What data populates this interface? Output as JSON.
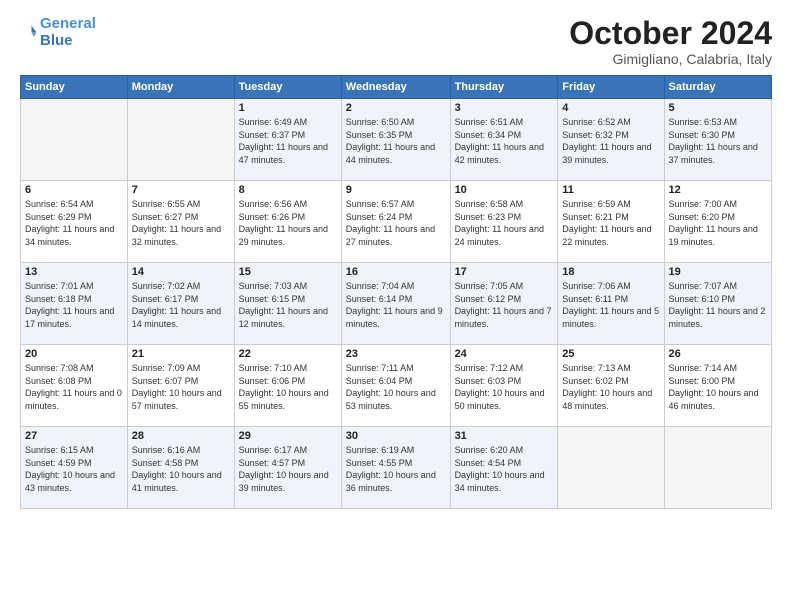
{
  "header": {
    "logo_line1": "General",
    "logo_line2": "Blue",
    "month_title": "October 2024",
    "location": "Gimigliano, Calabria, Italy"
  },
  "days_of_week": [
    "Sunday",
    "Monday",
    "Tuesday",
    "Wednesday",
    "Thursday",
    "Friday",
    "Saturday"
  ],
  "weeks": [
    [
      {
        "num": "",
        "detail": ""
      },
      {
        "num": "",
        "detail": ""
      },
      {
        "num": "1",
        "detail": "Sunrise: 6:49 AM\nSunset: 6:37 PM\nDaylight: 11 hours\nand 47 minutes."
      },
      {
        "num": "2",
        "detail": "Sunrise: 6:50 AM\nSunset: 6:35 PM\nDaylight: 11 hours\nand 44 minutes."
      },
      {
        "num": "3",
        "detail": "Sunrise: 6:51 AM\nSunset: 6:34 PM\nDaylight: 11 hours\nand 42 minutes."
      },
      {
        "num": "4",
        "detail": "Sunrise: 6:52 AM\nSunset: 6:32 PM\nDaylight: 11 hours\nand 39 minutes."
      },
      {
        "num": "5",
        "detail": "Sunrise: 6:53 AM\nSunset: 6:30 PM\nDaylight: 11 hours\nand 37 minutes."
      }
    ],
    [
      {
        "num": "6",
        "detail": "Sunrise: 6:54 AM\nSunset: 6:29 PM\nDaylight: 11 hours\nand 34 minutes."
      },
      {
        "num": "7",
        "detail": "Sunrise: 6:55 AM\nSunset: 6:27 PM\nDaylight: 11 hours\nand 32 minutes."
      },
      {
        "num": "8",
        "detail": "Sunrise: 6:56 AM\nSunset: 6:26 PM\nDaylight: 11 hours\nand 29 minutes."
      },
      {
        "num": "9",
        "detail": "Sunrise: 6:57 AM\nSunset: 6:24 PM\nDaylight: 11 hours\nand 27 minutes."
      },
      {
        "num": "10",
        "detail": "Sunrise: 6:58 AM\nSunset: 6:23 PM\nDaylight: 11 hours\nand 24 minutes."
      },
      {
        "num": "11",
        "detail": "Sunrise: 6:59 AM\nSunset: 6:21 PM\nDaylight: 11 hours\nand 22 minutes."
      },
      {
        "num": "12",
        "detail": "Sunrise: 7:00 AM\nSunset: 6:20 PM\nDaylight: 11 hours\nand 19 minutes."
      }
    ],
    [
      {
        "num": "13",
        "detail": "Sunrise: 7:01 AM\nSunset: 6:18 PM\nDaylight: 11 hours\nand 17 minutes."
      },
      {
        "num": "14",
        "detail": "Sunrise: 7:02 AM\nSunset: 6:17 PM\nDaylight: 11 hours\nand 14 minutes."
      },
      {
        "num": "15",
        "detail": "Sunrise: 7:03 AM\nSunset: 6:15 PM\nDaylight: 11 hours\nand 12 minutes."
      },
      {
        "num": "16",
        "detail": "Sunrise: 7:04 AM\nSunset: 6:14 PM\nDaylight: 11 hours\nand 9 minutes."
      },
      {
        "num": "17",
        "detail": "Sunrise: 7:05 AM\nSunset: 6:12 PM\nDaylight: 11 hours\nand 7 minutes."
      },
      {
        "num": "18",
        "detail": "Sunrise: 7:06 AM\nSunset: 6:11 PM\nDaylight: 11 hours\nand 5 minutes."
      },
      {
        "num": "19",
        "detail": "Sunrise: 7:07 AM\nSunset: 6:10 PM\nDaylight: 11 hours\nand 2 minutes."
      }
    ],
    [
      {
        "num": "20",
        "detail": "Sunrise: 7:08 AM\nSunset: 6:08 PM\nDaylight: 11 hours\nand 0 minutes."
      },
      {
        "num": "21",
        "detail": "Sunrise: 7:09 AM\nSunset: 6:07 PM\nDaylight: 10 hours\nand 57 minutes."
      },
      {
        "num": "22",
        "detail": "Sunrise: 7:10 AM\nSunset: 6:06 PM\nDaylight: 10 hours\nand 55 minutes."
      },
      {
        "num": "23",
        "detail": "Sunrise: 7:11 AM\nSunset: 6:04 PM\nDaylight: 10 hours\nand 53 minutes."
      },
      {
        "num": "24",
        "detail": "Sunrise: 7:12 AM\nSunset: 6:03 PM\nDaylight: 10 hours\nand 50 minutes."
      },
      {
        "num": "25",
        "detail": "Sunrise: 7:13 AM\nSunset: 6:02 PM\nDaylight: 10 hours\nand 48 minutes."
      },
      {
        "num": "26",
        "detail": "Sunrise: 7:14 AM\nSunset: 6:00 PM\nDaylight: 10 hours\nand 46 minutes."
      }
    ],
    [
      {
        "num": "27",
        "detail": "Sunrise: 6:15 AM\nSunset: 4:59 PM\nDaylight: 10 hours\nand 43 minutes."
      },
      {
        "num": "28",
        "detail": "Sunrise: 6:16 AM\nSunset: 4:58 PM\nDaylight: 10 hours\nand 41 minutes."
      },
      {
        "num": "29",
        "detail": "Sunrise: 6:17 AM\nSunset: 4:57 PM\nDaylight: 10 hours\nand 39 minutes."
      },
      {
        "num": "30",
        "detail": "Sunrise: 6:19 AM\nSunset: 4:55 PM\nDaylight: 10 hours\nand 36 minutes."
      },
      {
        "num": "31",
        "detail": "Sunrise: 6:20 AM\nSunset: 4:54 PM\nDaylight: 10 hours\nand 34 minutes."
      },
      {
        "num": "",
        "detail": ""
      },
      {
        "num": "",
        "detail": ""
      }
    ]
  ]
}
